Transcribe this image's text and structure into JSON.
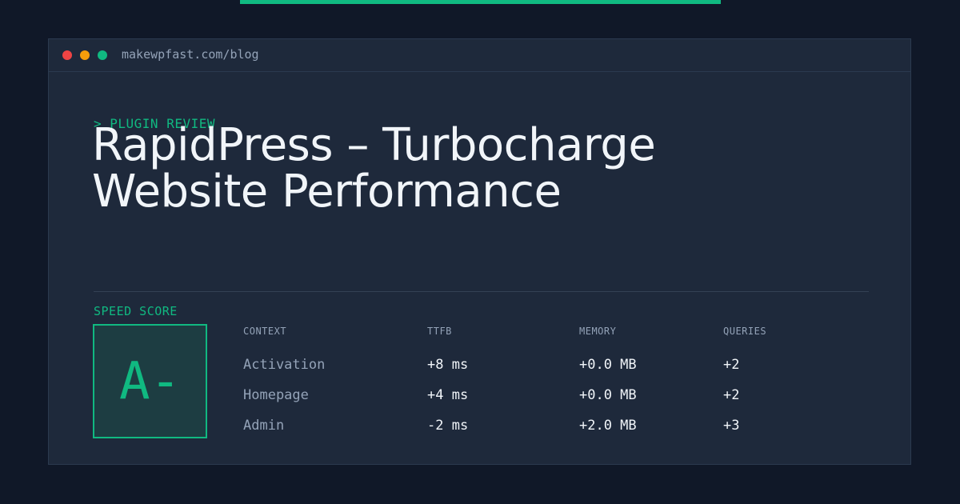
{
  "window": {
    "url": "makewpfast.com/blog",
    "traffic_lights": [
      "close",
      "minimize",
      "maximize"
    ]
  },
  "article": {
    "kicker": "> PLUGIN REVIEW",
    "title_line_1": "RapidPress – Turbocharge",
    "title_line_2": "Website Performance"
  },
  "score": {
    "label": "SPEED SCORE",
    "grade": "A-"
  },
  "metrics": {
    "headers": [
      "CONTEXT",
      "TTFB",
      "MEMORY",
      "QUERIES"
    ],
    "rows": [
      [
        "Activation",
        "+8 ms",
        "+0.0 MB",
        "+2"
      ],
      [
        "Homepage",
        "+4 ms",
        "+0.0 MB",
        "+2"
      ],
      [
        "Admin",
        "-2 ms",
        "+2.0 MB",
        "+3"
      ]
    ]
  },
  "colors": {
    "accent": "#10b981",
    "background": "#101828",
    "card": "#1e293b",
    "text": "#f1f5f9",
    "muted": "#94a3b8"
  }
}
